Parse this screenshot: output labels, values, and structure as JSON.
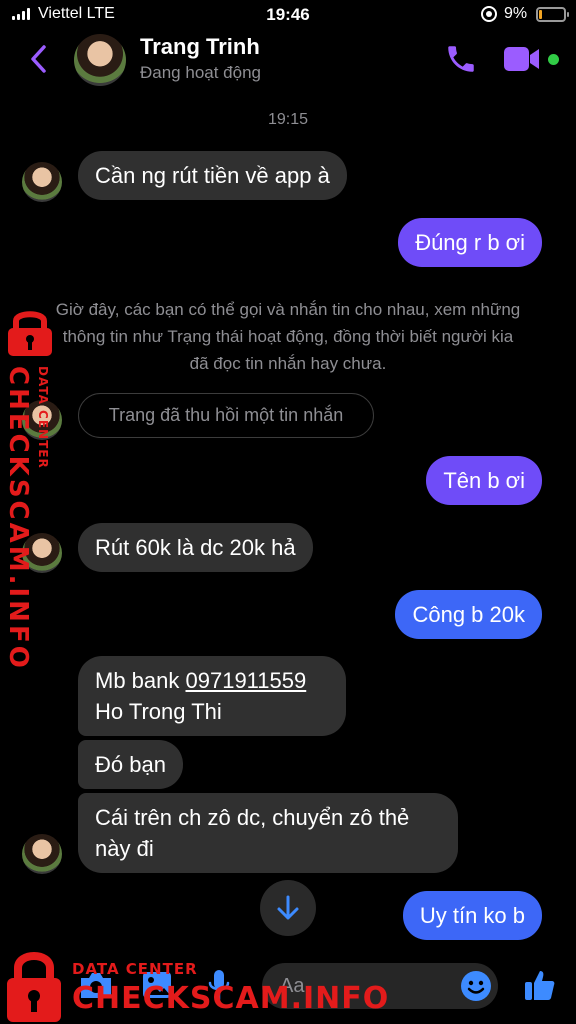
{
  "status_bar": {
    "carrier": "Viettel  LTE",
    "time": "19:46",
    "battery": "9%"
  },
  "header": {
    "name": "Trang Trinh",
    "status": "Đang hoạt động"
  },
  "timestamp": "19:15",
  "messages": [
    {
      "from": "them",
      "text": "Cần ng rút tiền về app à"
    },
    {
      "from": "me",
      "text": "Đúng r b ơi"
    },
    {
      "from": "me",
      "text": "Tên b ơi"
    },
    {
      "from": "them",
      "text": "Rút 60k là dc 20k hả"
    },
    {
      "from": "me",
      "text": "Công b 20k"
    },
    {
      "from": "them",
      "line1_prefix": "Mb bank ",
      "line1_link": "0971911559",
      "line2": "Ho Trong Thi"
    },
    {
      "from": "them",
      "text": "Đó bạn"
    },
    {
      "from": "them",
      "line1": "Cái trên ch zô dc, chuyển zô thẻ",
      "line2": "này đi"
    },
    {
      "from": "me",
      "text": "Uy tín ko b"
    }
  ],
  "system": {
    "info_line1": "Giờ đây, các bạn có thể gọi và nhắn tin cho nhau, xem những",
    "info_line2": "thông tin như Trạng thái hoạt động, đồng thời biết người kia",
    "info_line3": "đã đọc tin nhắn hay chưa.",
    "unsent": "Trang đã thu hồi một tin nhắn"
  },
  "composer": {
    "placeholder": "Aa"
  },
  "watermark": {
    "small": "DATA CENTER",
    "big": "CHECKSCAM.INFO"
  },
  "colors": {
    "accent": "#9b5cff",
    "bubble_out": "#6f4cf8",
    "bubble_out_blue": "#3d67f7",
    "bubble_in": "#303030",
    "online": "#31cc46",
    "watermark": "#e31b1b"
  },
  "icons": [
    "back-chevron-icon",
    "phone-icon",
    "video-camera-icon",
    "scroll-down-arrow-icon",
    "camera-icon",
    "image-icon",
    "microphone-icon",
    "emoji-icon",
    "thumbs-up-icon",
    "padlock-icon"
  ]
}
